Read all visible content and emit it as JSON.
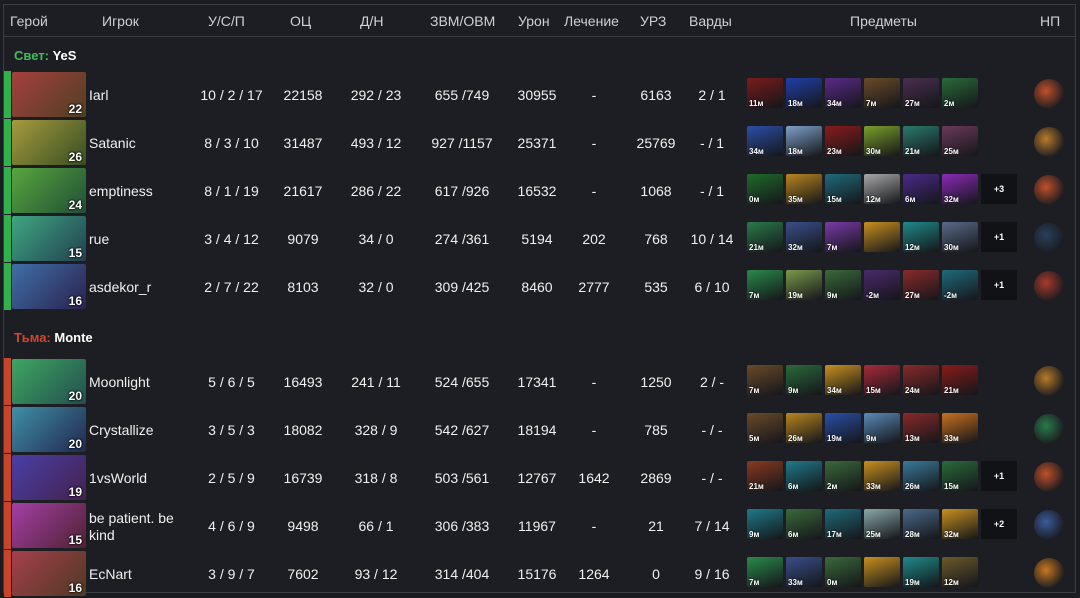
{
  "columns": {
    "hero": "Герой",
    "player": "Игрок",
    "kda": "У/С/П",
    "score": "ОЦ",
    "lhd": "Д/Н",
    "gpm": "ЗВМ/ОВМ",
    "damage": "Урон",
    "heal": "Лечение",
    "bd": "УРЗ",
    "wards": "Варды",
    "items": "Предметы",
    "np": "НП"
  },
  "teams": [
    {
      "side": "Свет:",
      "name": "YeS",
      "side_color": "#3fbf5a",
      "bar_color": "#2fb24b",
      "players": [
        {
          "level": "22",
          "name": "Iarl",
          "kda": "10 / 2 / 17",
          "score": "22158",
          "lhd": "292 / 23",
          "gpm": "655 /749",
          "damage": "30955",
          "heal": "-",
          "bd": "6163",
          "wards": "2 / 1",
          "items": [
            {
              "t": "11м",
              "c": "#7a1b1b"
            },
            {
              "t": "18м",
              "c": "#1f3fa8"
            },
            {
              "t": "34м",
              "c": "#5b2a8a"
            },
            {
              "t": "7м",
              "c": "#6b4a2a"
            },
            {
              "t": "27м",
              "c": "#4a2f4f"
            },
            {
              "t": "2м",
              "c": "#2a6b3a"
            }
          ],
          "more": "",
          "np": "#c0502a"
        },
        {
          "level": "26",
          "name": "Satanic",
          "kda": "8 / 3 / 10",
          "score": "31487",
          "lhd": "493 / 12",
          "gpm": "927 /1157",
          "damage": "25371",
          "heal": "-",
          "bd": "25769",
          "wards": "- / 1",
          "items": [
            {
              "t": "34м",
              "c": "#2a4fa8"
            },
            {
              "t": "18м",
              "c": "#7ea0c8"
            },
            {
              "t": "23м",
              "c": "#8a1b1b"
            },
            {
              "t": "30м",
              "c": "#7aa02a"
            },
            {
              "t": "21м",
              "c": "#2a7a6b"
            },
            {
              "t": "25м",
              "c": "#6b3a5a"
            }
          ],
          "more": "",
          "np": "#b87a2a"
        },
        {
          "level": "24",
          "name": "emptiness",
          "kda": "8 / 1 / 19",
          "score": "21617",
          "lhd": "286 / 22",
          "gpm": "617 /926",
          "damage": "16532",
          "heal": "-",
          "bd": "1068",
          "wards": "- / 1",
          "items": [
            {
              "t": "0м",
              "c": "#1f6b2a"
            },
            {
              "t": "35м",
              "c": "#b8861f"
            },
            {
              "t": "15м",
              "c": "#1f6b7a"
            },
            {
              "t": "12м",
              "c": "#a8a8a8"
            },
            {
              "t": "6м",
              "c": "#4a2a8a"
            },
            {
              "t": "32м",
              "c": "#8a2ab8"
            }
          ],
          "more": "+3",
          "np": "#c0502a"
        },
        {
          "level": "15",
          "name": "rue",
          "kda": "3 / 4 / 12",
          "score": "9079",
          "lhd": "34 / 0",
          "gpm": "274 /361",
          "damage": "5194",
          "heal": "202",
          "bd": "768",
          "wards": "10 / 14",
          "items": [
            {
              "t": "21м",
              "c": "#2a7a4a"
            },
            {
              "t": "32м",
              "c": "#3a4f8a"
            },
            {
              "t": "7м",
              "c": "#7a3aa8"
            },
            {
              "t": "",
              "c": "#c8901f"
            },
            {
              "t": "12м",
              "c": "#1f8a8a"
            },
            {
              "t": "30м",
              "c": "#5a6a8a"
            }
          ],
          "more": "+1",
          "np": "#2a3f5a"
        },
        {
          "level": "16",
          "name": "asdekor_r",
          "kda": "2 / 7 / 22",
          "score": "8103",
          "lhd": "32 / 0",
          "gpm": "309 /425",
          "damage": "8460",
          "heal": "2777",
          "bd": "535",
          "wards": "6 / 10",
          "items": [
            {
              "t": "7м",
              "c": "#2a8a4a"
            },
            {
              "t": "19м",
              "c": "#7a9a4a"
            },
            {
              "t": "9м",
              "c": "#3a6a3a"
            },
            {
              "t": "-2м",
              "c": "#4a2a6b"
            },
            {
              "t": "27м",
              "c": "#8a2a2a"
            },
            {
              "t": "-2м",
              "c": "#1f6b7a"
            }
          ],
          "more": "+1",
          "np": "#a83a2a"
        }
      ]
    },
    {
      "side": "Тьма:",
      "name": "Monte",
      "side_color": "#d2462d",
      "bar_color": "#c8452a",
      "players": [
        {
          "level": "20",
          "name": "Moonlight",
          "kda": "5 / 6 / 5",
          "score": "16493",
          "lhd": "241 / 11",
          "gpm": "524 /655",
          "damage": "17341",
          "heal": "-",
          "bd": "1250",
          "wards": "2 / -",
          "items": [
            {
              "t": "7м",
              "c": "#6b4a2a"
            },
            {
              "t": "9м",
              "c": "#2a6b3a"
            },
            {
              "t": "34м",
              "c": "#c8901f"
            },
            {
              "t": "15м",
              "c": "#a82a3a"
            },
            {
              "t": "24м",
              "c": "#8a2a2a"
            },
            {
              "t": "21м",
              "c": "#8a1b1b"
            }
          ],
          "more": "",
          "np": "#b87a2a"
        },
        {
          "level": "20",
          "name": "Crystallize",
          "kda": "3 / 5 / 3",
          "score": "18082",
          "lhd": "328 / 9",
          "gpm": "542 /627",
          "damage": "18194",
          "heal": "-",
          "bd": "785",
          "wards": "- / -",
          "items": [
            {
              "t": "5м",
              "c": "#6b4a2a"
            },
            {
              "t": "26м",
              "c": "#b8861f"
            },
            {
              "t": "19м",
              "c": "#2a4fa8"
            },
            {
              "t": "9м",
              "c": "#5a8ab8"
            },
            {
              "t": "13м",
              "c": "#8a2a2a"
            },
            {
              "t": "33м",
              "c": "#c8701f"
            }
          ],
          "more": "",
          "np": "#2a7a4a"
        },
        {
          "level": "19",
          "name": "1vsWorld",
          "kda": "2 / 5 / 9",
          "score": "16739",
          "lhd": "318 / 8",
          "gpm": "503 /561",
          "damage": "12767",
          "heal": "1642",
          "bd": "2869",
          "wards": "- / -",
          "items": [
            {
              "t": "21м",
              "c": "#8a3a1f"
            },
            {
              "t": "6м",
              "c": "#1f7a8a"
            },
            {
              "t": "2м",
              "c": "#3a6a3a"
            },
            {
              "t": "33м",
              "c": "#c8901f"
            },
            {
              "t": "26м",
              "c": "#3a7a9a"
            },
            {
              "t": "15м",
              "c": "#2a6b3a"
            }
          ],
          "more": "+1",
          "np": "#c0502a"
        },
        {
          "level": "15",
          "name": "be patient. be kind",
          "kda": "4 / 6 / 9",
          "score": "9498",
          "lhd": "66 / 1",
          "gpm": "306 /383",
          "damage": "11967",
          "heal": "-",
          "bd": "21",
          "wards": "7 / 14",
          "items": [
            {
              "t": "9м",
              "c": "#1f7a8a"
            },
            {
              "t": "6м",
              "c": "#3a6a3a"
            },
            {
              "t": "17м",
              "c": "#1f6b7a"
            },
            {
              "t": "25м",
              "c": "#8aa8a8"
            },
            {
              "t": "28м",
              "c": "#4a6a8a"
            },
            {
              "t": "32м",
              "c": "#c8901f"
            }
          ],
          "more": "+2",
          "np": "#3a5a9a"
        },
        {
          "level": "16",
          "name": "EcNart",
          "kda": "3 / 9 / 7",
          "score": "7602",
          "lhd": "93 / 12",
          "gpm": "314 /404",
          "damage": "15176",
          "heal": "1264",
          "bd": "0",
          "wards": "9 / 16",
          "items": [
            {
              "t": "7м",
              "c": "#2a8a4a"
            },
            {
              "t": "33м",
              "c": "#3a4f8a"
            },
            {
              "t": "0м",
              "c": "#3a6a3a"
            },
            {
              "t": "",
              "c": "#c8901f"
            },
            {
              "t": "19м",
              "c": "#1f8a8a"
            },
            {
              "t": "12м",
              "c": "#6b5a2a"
            }
          ],
          "more": "",
          "np": "#c8781f"
        }
      ]
    }
  ]
}
